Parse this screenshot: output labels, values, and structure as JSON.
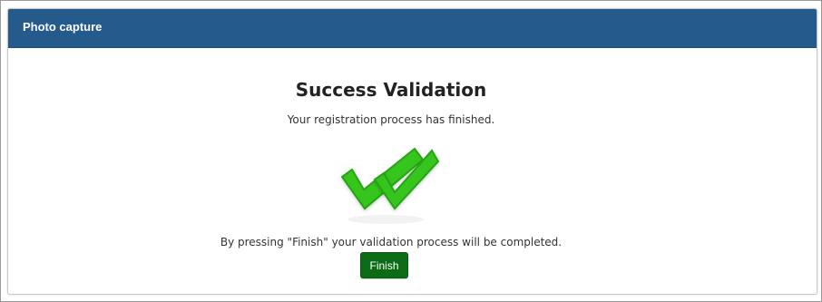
{
  "header": {
    "title": "Photo capture",
    "background_color": "#245a8c"
  },
  "main": {
    "title": "Success Validation",
    "message": "Your registration process has finished.",
    "instruction": "By pressing \"Finish\" your validation process will be completed.",
    "icon": "double-checkmark-icon",
    "check_color": "#2fbf1a"
  },
  "actions": {
    "finish_label": "Finish",
    "finish_color": "#0c6b15"
  }
}
